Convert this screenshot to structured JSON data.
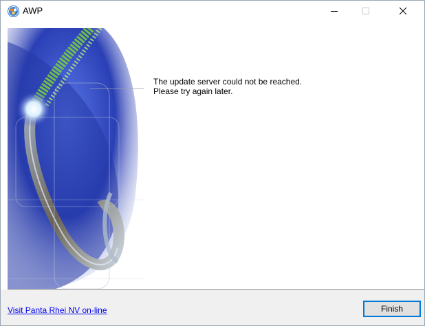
{
  "window": {
    "title": "AWP",
    "icon": "awp-app-icon",
    "controls": {
      "minimize_icon": "minimize-icon",
      "maximize_icon": "maximize-icon",
      "close_icon": "close-icon"
    }
  },
  "message": {
    "line1": "The update server could not be reached.",
    "line2": "Please try again later."
  },
  "footer": {
    "link_text": "Visit Panta Rhei NV on-line",
    "finish_label": "Finish"
  },
  "colors": {
    "link": "#0000ee",
    "button_focus_border": "#0078d7",
    "footer_bg": "#f0f0f0",
    "art_blue": "#2a3fb5",
    "art_green": "#7bd33a"
  }
}
